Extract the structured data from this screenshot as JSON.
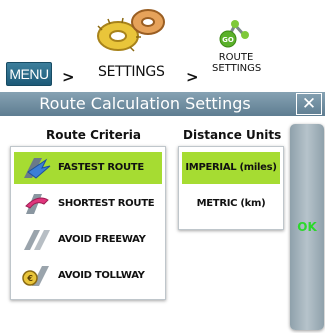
{
  "breadcrumb": {
    "menu_label": "MENU",
    "separator": ">",
    "settings_label": "SETTINGS",
    "route_settings_label": "ROUTE\nSETTINGS",
    "route_settings_line1": "ROUTE",
    "route_settings_line2": "SETTINGS",
    "go_badge": "GO"
  },
  "dialog": {
    "title": "Route Calculation Settings",
    "close_icon": "close-icon"
  },
  "route_criteria": {
    "heading": "Route Criteria",
    "options": [
      {
        "label": "FASTEST ROUTE",
        "icon": "fastest-route-icon",
        "selected": true
      },
      {
        "label": "SHORTEST ROUTE",
        "icon": "shortest-route-icon",
        "selected": false
      },
      {
        "label": "AVOID FREEWAY",
        "icon": "avoid-freeway-icon",
        "selected": false
      },
      {
        "label": "AVOID TOLLWAY",
        "icon": "avoid-tollway-icon",
        "selected": false
      }
    ]
  },
  "distance_units": {
    "heading": "Distance Units",
    "options": [
      {
        "label": "IMPERIAL (miles)",
        "selected": true
      },
      {
        "label": "METRIC (km)",
        "selected": false
      }
    ]
  },
  "ok_button": {
    "label": "OK"
  },
  "colors": {
    "selected": "#a6dc32",
    "title_bar": "#6f8ca0",
    "ok_text": "#2bd82b"
  }
}
